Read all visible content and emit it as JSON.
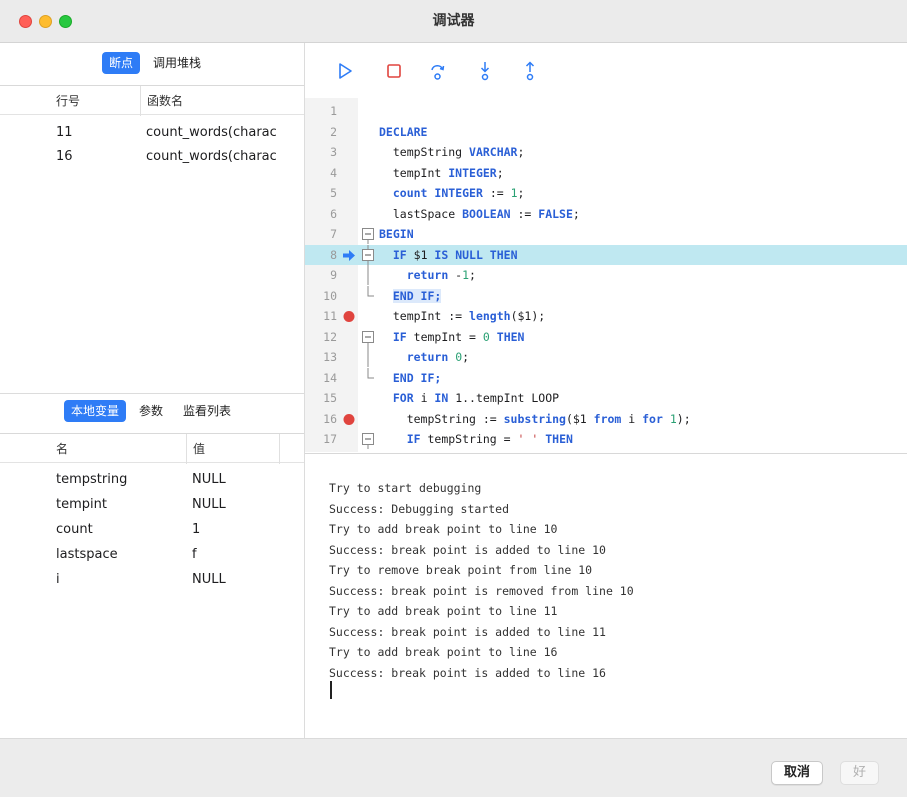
{
  "window": {
    "title": "调试器"
  },
  "breakpoints_panel": {
    "tabs": [
      {
        "label": "断点",
        "active": true
      },
      {
        "label": "调用堆栈",
        "active": false
      }
    ],
    "columns": [
      "行号",
      "函数名"
    ],
    "rows": [
      {
        "line": "11",
        "function": "count_words(charac"
      },
      {
        "line": "16",
        "function": "count_words(charac"
      }
    ]
  },
  "variables_panel": {
    "tabs": [
      {
        "label": "本地变量",
        "active": true
      },
      {
        "label": "参数",
        "active": false
      },
      {
        "label": "监看列表",
        "active": false
      }
    ],
    "columns": [
      "名",
      "值"
    ],
    "rows": [
      {
        "name": "tempstring",
        "value": "NULL"
      },
      {
        "name": "tempint",
        "value": "NULL"
      },
      {
        "name": "count",
        "value": "1"
      },
      {
        "name": "lastspace",
        "value": "f"
      },
      {
        "name": "i",
        "value": "NULL"
      }
    ]
  },
  "toolbar": {
    "buttons": [
      {
        "name": "continue",
        "icon": "play-icon",
        "color": "#2e7cf6"
      },
      {
        "name": "stop",
        "icon": "stop-icon",
        "color": "#e0443e"
      },
      {
        "name": "step-over",
        "icon": "step-over-icon",
        "color": "#2e7cf6"
      },
      {
        "name": "step-into",
        "icon": "step-into-icon",
        "color": "#2e7cf6"
      },
      {
        "name": "step-out",
        "icon": "step-out-icon",
        "color": "#2e7cf6"
      }
    ]
  },
  "editor": {
    "current_line": 8,
    "breakpoint_lines": [
      11,
      16
    ],
    "lines": [
      {
        "n": "1",
        "text": ""
      },
      {
        "n": "2",
        "text": "DECLARE"
      },
      {
        "n": "3",
        "text": "  tempString VARCHAR;"
      },
      {
        "n": "4",
        "text": "  tempInt INTEGER;"
      },
      {
        "n": "5",
        "text": "  count INTEGER := 1;"
      },
      {
        "n": "6",
        "text": "  lastSpace BOOLEAN := FALSE;"
      },
      {
        "n": "7",
        "text": "BEGIN"
      },
      {
        "n": "8",
        "text": "  IF $1 IS NULL THEN"
      },
      {
        "n": "9",
        "text": "    return -1;"
      },
      {
        "n": "10",
        "text": "  END IF;"
      },
      {
        "n": "11",
        "text": "  tempInt := length($1);"
      },
      {
        "n": "12",
        "text": "  IF tempInt = 0 THEN"
      },
      {
        "n": "13",
        "text": "    return 0;"
      },
      {
        "n": "14",
        "text": "  END IF;"
      },
      {
        "n": "15",
        "text": "  FOR i IN 1..tempInt LOOP"
      },
      {
        "n": "16",
        "text": "    tempString := substring($1 from i for 1);"
      },
      {
        "n": "17",
        "text": "    IF tempString = ' ' THEN"
      }
    ]
  },
  "console": {
    "lines": [
      "Try to start debugging",
      "Success: Debugging started",
      "Try to add break point to line 10",
      "Success: break point is added to line 10",
      "Try to remove break point from line 10",
      "Success: break point is removed from line 10",
      "Try to add break point to line 11",
      "Success: break point is added to line 11",
      "Try to add break point to line 16",
      "Success: break point is added to line 16"
    ]
  },
  "footer": {
    "cancel_label": "取消",
    "ok_label": "好"
  },
  "colors": {
    "accent": "#2e7cf6",
    "current_line_bg": "#bfe8f1",
    "breakpoint": "#e0443e",
    "keyword": "#2a5fd6",
    "number": "#29a073",
    "string": "#c43d3d"
  }
}
